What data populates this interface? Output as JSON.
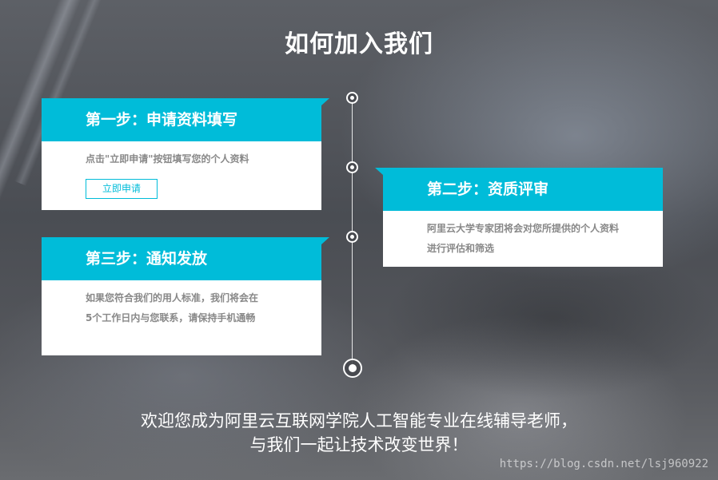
{
  "page": {
    "title": "如何加入我们"
  },
  "steps": [
    {
      "title": "第一步：申请资料填写",
      "lines": [
        "点击\"立即申请\"按钮填写您的个人资料"
      ],
      "button_label": "立即申请"
    },
    {
      "title": "第二步：资质评审",
      "lines": [
        "阿里云大学专家团将会对您所提供的个人资料",
        "进行评估和筛选"
      ]
    },
    {
      "title": "第三步：通知发放",
      "lines": [
        "如果您符合我们的用人标准，我们将会在",
        "5个工作日内与您联系，请保持手机通畅"
      ]
    }
  ],
  "footer": {
    "line1": "欢迎您成为阿里云互联网学院人工智能专业在线辅导老师，",
    "line2": "与我们一起让技术改变世界！"
  },
  "watermark": "https://blog.csdn.net/lsj960922",
  "colors": {
    "accent": "#00bcd9",
    "card_text": "#888888"
  }
}
